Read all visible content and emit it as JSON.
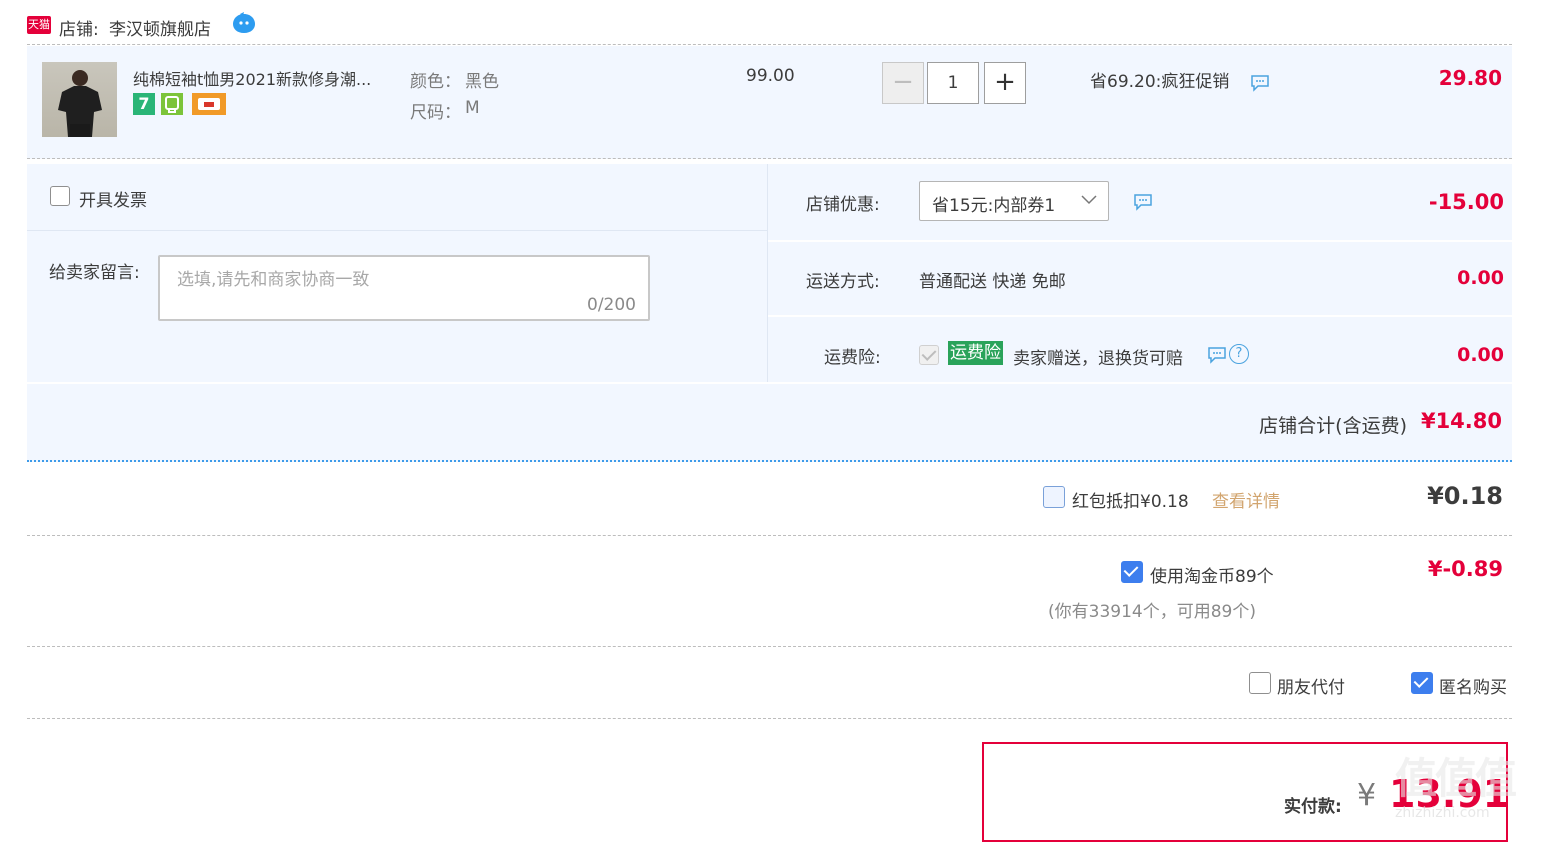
{
  "shop": {
    "badge": "天猫",
    "label": "店铺:",
    "name": "李汉顿旗舰店"
  },
  "item": {
    "title": "纯棉短袖t恤男2021新款修身潮...",
    "color_label": "颜色：",
    "color_value": "黑色",
    "size_label": "尺码：",
    "size_value": "M",
    "unit_price": "99.00",
    "quantity": "1",
    "promo": "省69.20:疯狂促销",
    "subtotal": "29.80",
    "badges": [
      "seven-day-return-icon",
      "service-badge-icon",
      "card-payment-icon"
    ]
  },
  "invoice": {
    "label": "开具发票"
  },
  "message": {
    "label": "给卖家留言:",
    "placeholder": "选填,请先和商家协商一致",
    "counter": "0/200"
  },
  "discount": {
    "label": "店铺优惠:",
    "selected": "省15元:内部券1",
    "amount": "-15.00"
  },
  "shipping": {
    "label": "运送方式:",
    "value": "普通配送 快递 免邮",
    "amount": "0.00"
  },
  "insurance": {
    "label": "运费险:",
    "tag": "运费险",
    "text": "卖家赠送，退换货可赔",
    "amount": "0.00"
  },
  "shop_total": {
    "label": "店铺合计(含运费)",
    "amount": "¥14.80"
  },
  "redpacket": {
    "label": "红包抵扣¥0.18",
    "link": "查看详情",
    "amount": "¥0.18"
  },
  "coins": {
    "label": "使用淘金币89个",
    "note": "(你有33914个，可用89个)",
    "amount": "¥-0.89"
  },
  "options": {
    "friend_pay": "朋友代付",
    "anonymous": "匿名购买"
  },
  "payment": {
    "label": "实付款:",
    "currency": "¥",
    "amount": "13.91"
  },
  "watermark": {
    "text": "值值值",
    "domain": "zhizhizhi.com"
  },
  "colors": {
    "accent_red": "#e4003a",
    "row_bg": "#f2f7ff",
    "checkbox_blue": "#3d7eee",
    "insurance_green": "#2aa35a"
  }
}
